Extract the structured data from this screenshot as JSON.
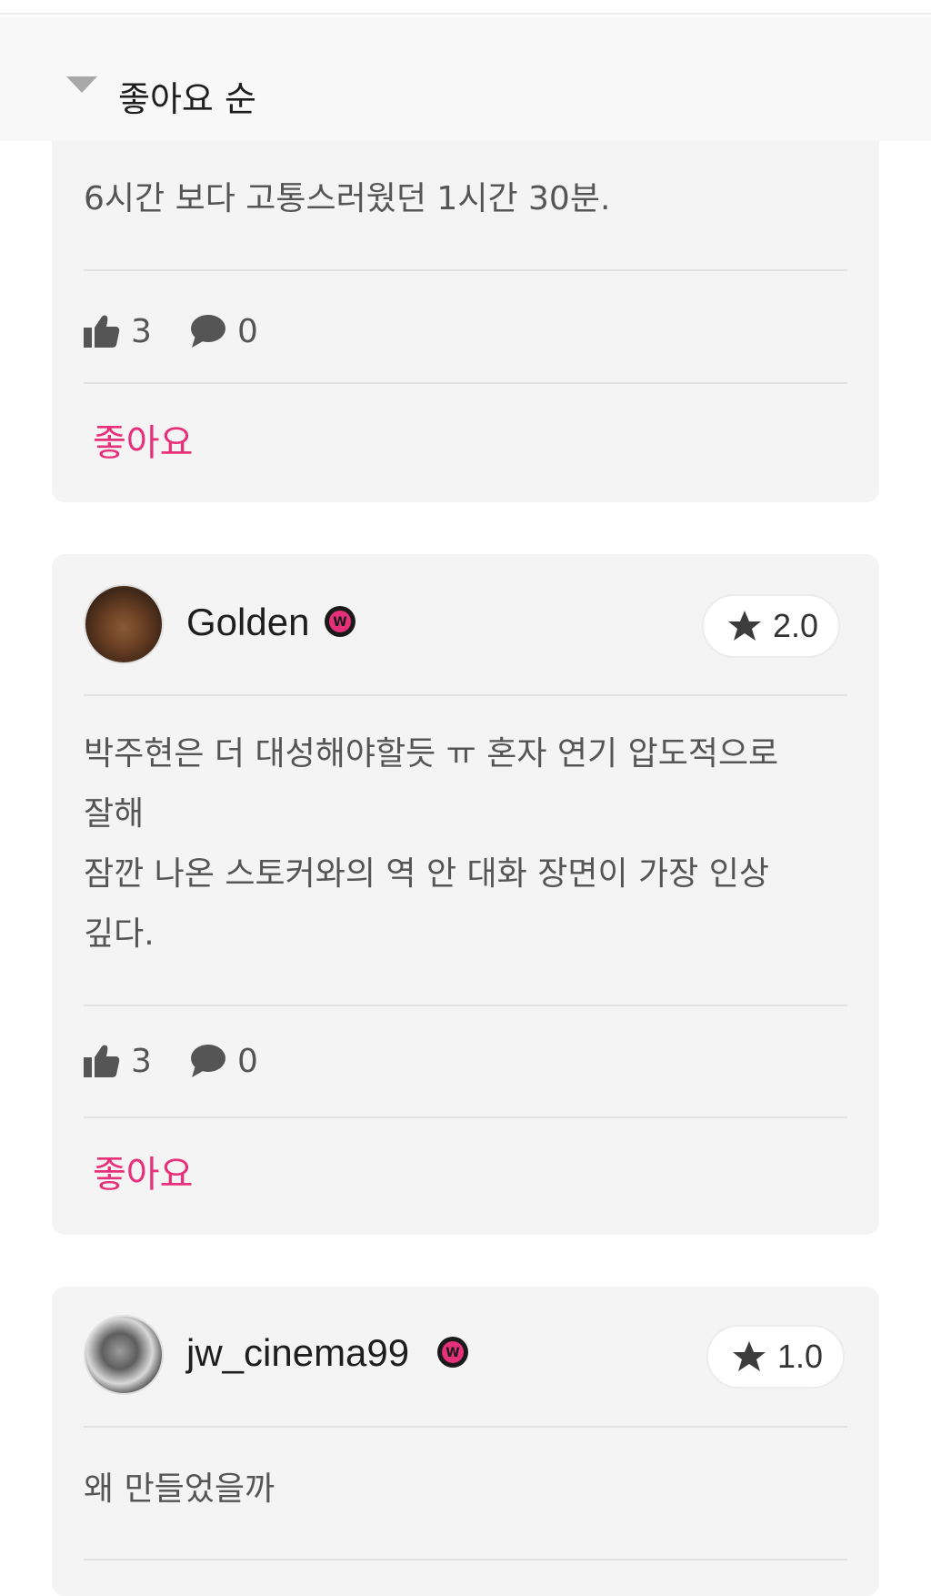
{
  "sort": {
    "label": "좋아요 순"
  },
  "reviews": [
    {
      "text": "6시간 보다 고통스러웠던 1시간 30분.",
      "likes": "3",
      "comments": "0",
      "like_button": "좋아요"
    },
    {
      "username": "Golden",
      "rating": "2.0",
      "text": "박주현은 더 대성해야할듯 ㅠ 혼자 연기 압도적으로\n잘해\n잠깐 나온 스토커와의 역 안 대화 장면이 가장 인상\n깊다.",
      "likes": "3",
      "comments": "0",
      "like_button": "좋아요"
    },
    {
      "username": "jw_cinema99",
      "rating": "1.0",
      "text": "왜 만들었을까"
    }
  ],
  "colors": {
    "accent": "#e6307a",
    "card_bg": "#f4f4f4",
    "badge": "#e6307a"
  },
  "icons": [
    "chevron-down-icon",
    "thumbs-up-icon",
    "comment-icon",
    "star-icon",
    "verified-badge-icon"
  ]
}
